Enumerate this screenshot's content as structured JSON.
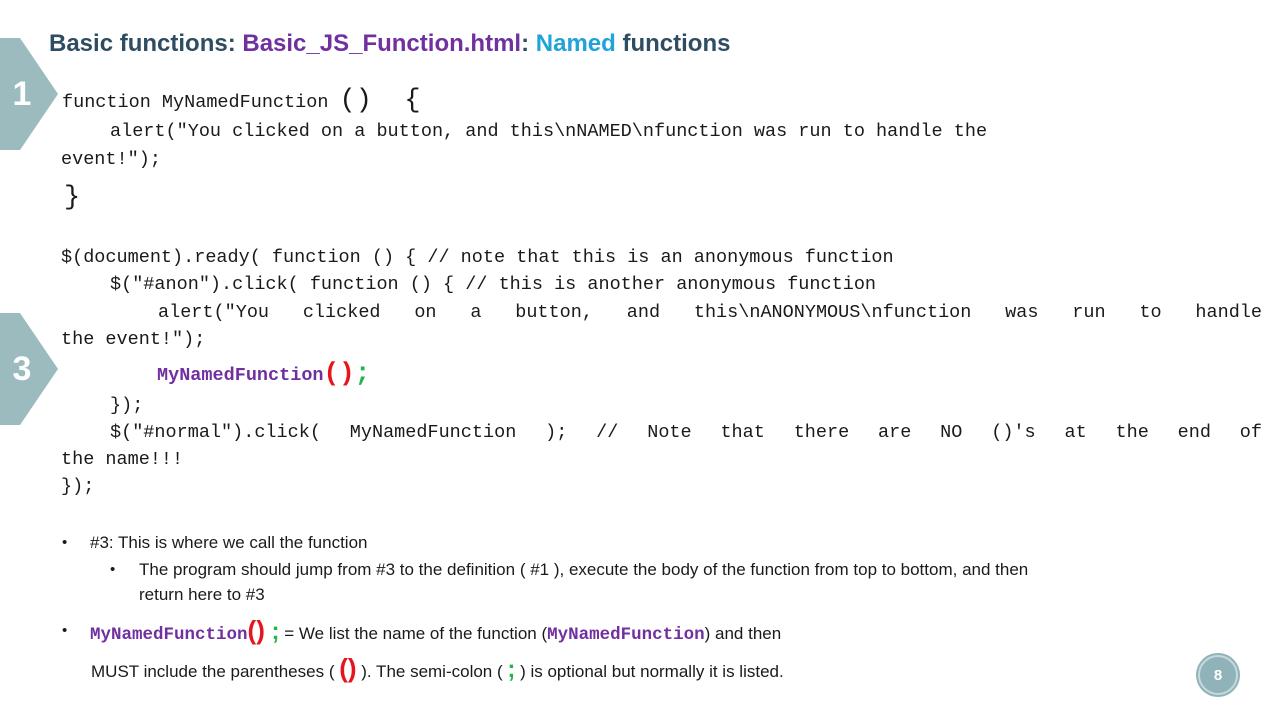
{
  "slide": {
    "title_prefix": "Basic functions: ",
    "title_file": "Basic_JS_Function.html",
    "title_colon": ": ",
    "title_named": "Named",
    "title_suffix": " functions",
    "step_markers": [
      "1",
      "3"
    ],
    "page_number": "8"
  },
  "code": {
    "l1_text": "function MyNamedFunction ",
    "l1_parens": "()",
    "l1_brace": "{",
    "l2": "alert(\"You clicked on a button, and this\\nNAMED\\nfunction was run to handle the",
    "l3": "event!\");",
    "l4_brace": "}",
    "l5": "$(document).ready( function () { // note that this is an anonymous function",
    "l6": "$(\"#anon\").click( function () { // this is another anonymous function",
    "l7": "alert(\"You clicked on a button, and this\\nANONYMOUS\\nfunction was run to handle",
    "l8": "the event!\");",
    "l9_name": "MyNamedFunction",
    "l9_parens": "()",
    "l9_semi": ";",
    "l10": "});",
    "l11": "$(\"#normal\").click( MyNamedFunction ); // Note that there are NO ()'s at the end of",
    "l12": "the name!!!",
    "l13": "});"
  },
  "bullets": {
    "b1": "#3: This is where we call the function",
    "b1_sub": "The program should jump from #3 to the definition ( #1 ), execute the body of the function from top to bottom, and then",
    "b1_sub_cont": "return here to #3",
    "b2_code_name": "MyNamedFunction",
    "b2_code_parens": "()",
    "b2_code_semi": ";",
    "b2_text_a": " = We list the name of the function (",
    "b2_name": "MyNamedFunction",
    "b2_text_b": ") and then",
    "b3_text_a": "MUST include the parentheses ( ",
    "b3_parens": "()",
    "b3_text_b": " ).  The semi-colon ( ",
    "b3_semi": ";",
    "b3_text_c": " ) is optional but normally it is listed."
  },
  "colors": {
    "title": "#2e4d63",
    "file_name": "#7030a0",
    "named": "#1fa3d8",
    "marker": "#9bbbbf",
    "highlight_call": "#7030a0",
    "parens": "#e8141d",
    "semicolon": "#22b54a"
  }
}
